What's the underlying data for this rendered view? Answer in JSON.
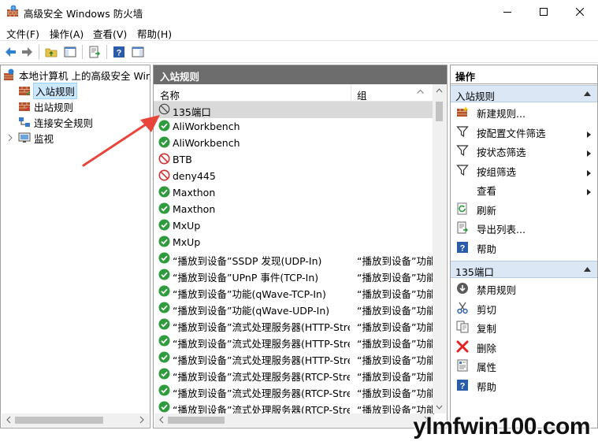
{
  "window": {
    "title": "高级安全 Windows 防火墙",
    "min_icon": "minimize-icon",
    "max_icon": "maximize-icon",
    "close_icon": "close-icon"
  },
  "menu": [
    "文件(F)",
    "操作(A)",
    "查看(V)",
    "帮助(H)"
  ],
  "toolbar": {
    "icons": [
      "back-arrow-icon",
      "forward-arrow-icon",
      "up-folder-icon",
      "show-hide-tree-icon",
      "export-list-icon",
      "help-icon",
      "show-hide-action-pane-icon"
    ]
  },
  "tree": {
    "root_label": "本地计算机 上的高级安全 Windows 防火墙",
    "items": [
      {
        "label": "入站规则",
        "icon": "inbound-rules-icon",
        "selected": true
      },
      {
        "label": "出站规则",
        "icon": "outbound-rules-icon",
        "selected": false
      },
      {
        "label": "连接安全规则",
        "icon": "connection-security-icon",
        "selected": false
      },
      {
        "label": "监视",
        "icon": "monitor-icon",
        "selected": false
      }
    ]
  },
  "middle": {
    "header": "入站规则",
    "columns": {
      "name": "名称",
      "group": "组"
    },
    "rows": [
      {
        "name": "135端口",
        "group": "",
        "status": "blocked",
        "selected": true
      },
      {
        "name": "AliWorkbench",
        "group": "",
        "status": "allowed"
      },
      {
        "name": "AliWorkbench",
        "group": "",
        "status": "allowed"
      },
      {
        "name": "BTB",
        "group": "",
        "status": "blocked"
      },
      {
        "name": "deny445",
        "group": "",
        "status": "blocked"
      },
      {
        "name": "Maxthon",
        "group": "",
        "status": "allowed"
      },
      {
        "name": "Maxthon",
        "group": "",
        "status": "allowed"
      },
      {
        "name": "MxUp",
        "group": "",
        "status": "allowed"
      },
      {
        "name": "MxUp",
        "group": "",
        "status": "allowed"
      },
      {
        "name": "“播放到设备”SSDP 发现(UDP-In)",
        "group": "“播放到设备”功能",
        "status": "allowed"
      },
      {
        "name": "“播放到设备”UPnP 事件(TCP-In)",
        "group": "“播放到设备”功能",
        "status": "allowed"
      },
      {
        "name": "“播放到设备”功能(qWave-TCP-In)",
        "group": "“播放到设备”功能",
        "status": "allowed"
      },
      {
        "name": "“播放到设备”功能(qWave-UDP-In)",
        "group": "“播放到设备”功能",
        "status": "allowed"
      },
      {
        "name": "“播放到设备”流式处理服务器(HTTP-Streaming-In)",
        "group": "“播放到设备”功能",
        "status": "allowed"
      },
      {
        "name": "“播放到设备”流式处理服务器(HTTP-Streaming-In)",
        "group": "“播放到设备”功能",
        "status": "allowed"
      },
      {
        "name": "“播放到设备”流式处理服务器(HTTP-Streaming-In)",
        "group": "“播放到设备”功能",
        "status": "allowed"
      },
      {
        "name": "“播放到设备”流式处理服务器(RTCP-Streaming-In)",
        "group": "“播放到设备”功能",
        "status": "allowed"
      },
      {
        "name": "“播放到设备”流式处理服务器(RTCP-Streaming-In)",
        "group": "“播放到设备”功能",
        "status": "allowed"
      },
      {
        "name": "“播放到设备”流式处理服务器(RTCP-Streaming-In)",
        "group": "“播放到设备”功能",
        "status": "allowed"
      }
    ]
  },
  "actions": {
    "header": "操作",
    "section1": {
      "title": "入站规则",
      "items": [
        {
          "label": "新建规则...",
          "icon": "new-rule-icon",
          "submenu": false
        },
        {
          "label": "按配置文件筛选",
          "icon": "filter-icon",
          "submenu": true
        },
        {
          "label": "按状态筛选",
          "icon": "filter-icon",
          "submenu": true
        },
        {
          "label": "按组筛选",
          "icon": "filter-icon",
          "submenu": true
        },
        {
          "label": "查看",
          "icon": "",
          "submenu": true
        },
        {
          "label": "刷新",
          "icon": "refresh-icon",
          "submenu": false
        },
        {
          "label": "导出列表...",
          "icon": "export-list-icon",
          "submenu": false
        },
        {
          "label": "帮助",
          "icon": "help-icon",
          "submenu": false
        }
      ]
    },
    "section2": {
      "title": "135端口",
      "items": [
        {
          "label": "禁用规则",
          "icon": "disable-rule-icon",
          "submenu": false
        },
        {
          "label": "剪切",
          "icon": "cut-icon",
          "submenu": false
        },
        {
          "label": "复制",
          "icon": "copy-icon",
          "submenu": false
        },
        {
          "label": "删除",
          "icon": "delete-icon",
          "submenu": false
        },
        {
          "label": "属性",
          "icon": "properties-icon",
          "submenu": false
        },
        {
          "label": "帮助",
          "icon": "help-icon",
          "submenu": false
        }
      ]
    }
  },
  "watermark": "ylmfwin100.com",
  "colors": {
    "allowed": "#2e9b3c",
    "blocked": "#d32f2f",
    "accent": "#1e62b4",
    "selection": "#cce8ff"
  }
}
